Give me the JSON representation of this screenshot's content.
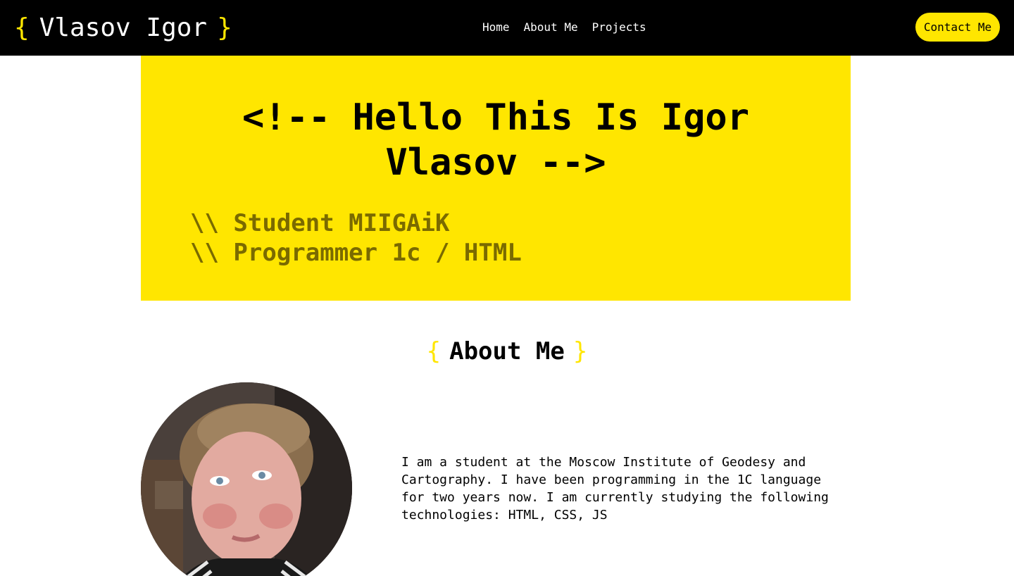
{
  "header": {
    "logo": {
      "open_brace": "{",
      "name": "Vlasov Igor",
      "close_brace": "}"
    },
    "nav": [
      "Home",
      "About Me",
      "Projects"
    ],
    "contact_label": "Contact Me"
  },
  "hero": {
    "title": "<!-- Hello This Is Igor Vlasov -->",
    "lines": [
      "\\\\ Student MIIGAiK",
      "\\\\ Programmer 1c / HTML"
    ]
  },
  "about": {
    "open_brace": "{",
    "heading": "About Me",
    "close_brace": "}",
    "text": "I am a student at the Moscow Institute of Geodesy and Cartography. I have been programming in the 1C language for two years now. I am currently studying the following technologies: HTML, CSS, JS"
  },
  "colors": {
    "accent": "#ffe600",
    "header_bg": "#000000",
    "subtitle": "#7a6a00"
  },
  "icons": {
    "avatar": "profile-photo"
  }
}
